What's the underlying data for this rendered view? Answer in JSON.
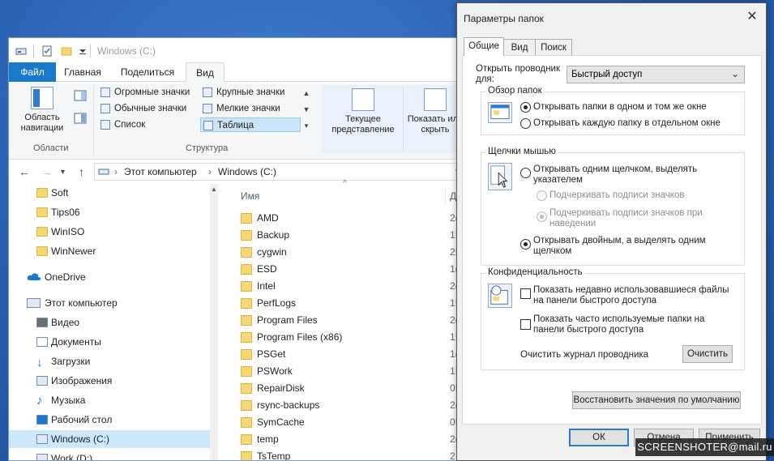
{
  "explorer": {
    "title": "Windows (C:)",
    "ribbon_tabs": [
      "Файл",
      "Главная",
      "Поделиться",
      "Вид"
    ],
    "ribbon": {
      "nav_pane_label": "Область навигации",
      "areas_group": "Области",
      "layout_items": [
        "Огромные значки",
        "Крупные значки",
        "Обычные значки",
        "Мелкие значки",
        "Список",
        "Таблица"
      ],
      "layout_selected": "Таблица",
      "structure_group": "Структура",
      "current_view_label": "Текущее представление",
      "show_hide_label": "Показать или скрыть"
    },
    "address": {
      "this_pc": "Этот компьютер",
      "drive": "Windows (C:)"
    },
    "nav_items": [
      "Soft",
      "Tips06",
      "WinISO",
      "WinNewer",
      "OneDrive",
      "Этот компьютер",
      "Видео",
      "Документы",
      "Загрузки",
      "Изображения",
      "Музыка",
      "Рабочий стол",
      "Windows (C:)",
      "Work (D:)"
    ],
    "nav_selected": "Windows (C:)",
    "columns": {
      "name": "Имя",
      "date": "Д"
    },
    "files": [
      {
        "name": "AMD",
        "date": "2("
      },
      {
        "name": "Backup",
        "date": "1!"
      },
      {
        "name": "cygwin",
        "date": "2!"
      },
      {
        "name": "ESD",
        "date": "1("
      },
      {
        "name": "Intel",
        "date": "2("
      },
      {
        "name": "PerfLogs",
        "date": "1!"
      },
      {
        "name": "Program Files",
        "date": "2("
      },
      {
        "name": "Program Files (x86)",
        "date": "1!"
      },
      {
        "name": "PSGet",
        "date": "1("
      },
      {
        "name": "PSWork",
        "date": "1!"
      },
      {
        "name": "RepairDisk",
        "date": "0!"
      },
      {
        "name": "rsync-backups",
        "date": "2("
      },
      {
        "name": "SymCache",
        "date": "0!"
      },
      {
        "name": "temp",
        "date": "2("
      },
      {
        "name": "TsTemp",
        "date": "2"
      }
    ]
  },
  "dialog": {
    "title": "Параметры папок",
    "close_glyph": "✕",
    "tabs": [
      "Общие",
      "Вид",
      "Поиск"
    ],
    "open_explorer_for_label": "Открыть проводник для:",
    "open_explorer_for_value": "Быстрый доступ",
    "browse_group": "Обзор папок",
    "browse_opt1": "Открывать папки в одном и том же окне",
    "browse_opt2": "Открывать каждую папку в отдельном окне",
    "click_group": "Щелчки мышью",
    "click_opt1": "Открывать одним щелчком, выделять указателем",
    "click_sub1": "Подчеркивать подписи значков",
    "click_sub2": "Подчеркивать подписи значков при наведении",
    "click_opt2": "Открывать двойным, а выделять одним щелчком",
    "privacy_group": "Конфиденциальность",
    "privacy_opt1": "Показать недавно использовавшиеся файлы на панели быстрого доступа",
    "privacy_opt2": "Показать часто используемые папки на панели быстрого доступа",
    "clear_history_label": "Очистить журнал проводника",
    "clear_button": "Очистить",
    "restore_button": "Восстановить значения по умолчанию",
    "ok_button": "ОК",
    "cancel_button": "Отмена",
    "apply_button": "Применить"
  },
  "watermark": "SCREENSHOTER@mail.ru"
}
